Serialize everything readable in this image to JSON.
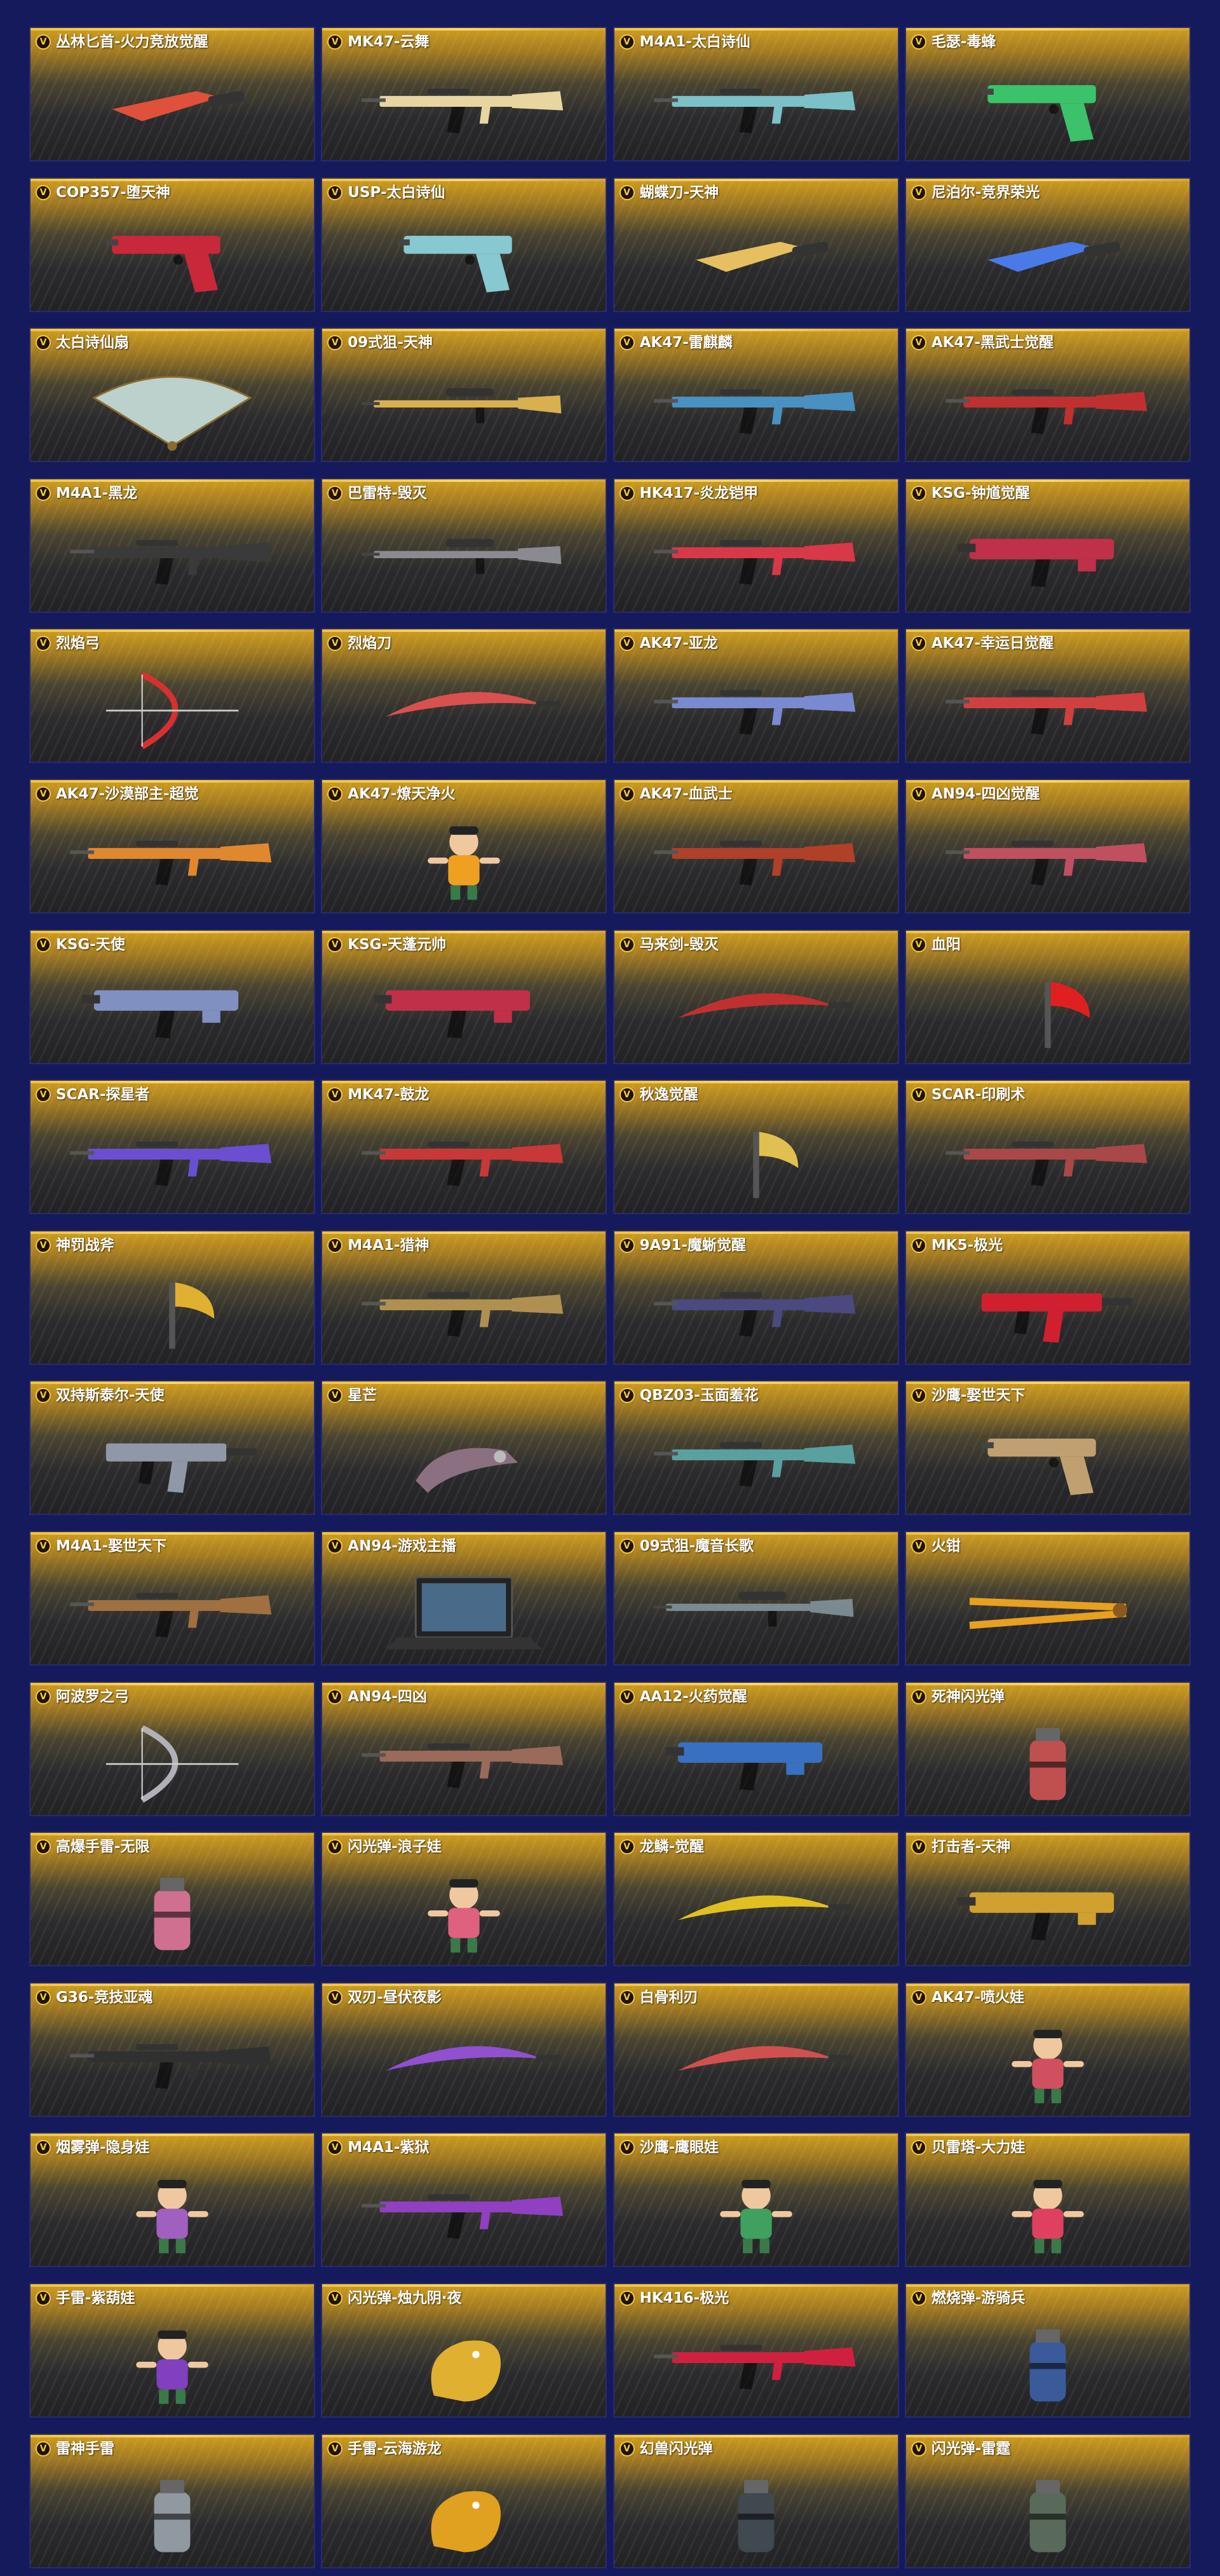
{
  "badge_letter": "V",
  "items": [
    {
      "name": "丛林匕首-火力竞放觉醒",
      "icon": "knife-icon",
      "color": "#e0503a"
    },
    {
      "name": "MK47-云舞",
      "icon": "rifle-icon",
      "color": "#e8d6a0"
    },
    {
      "name": "M4A1-太白诗仙",
      "icon": "rifle-icon",
      "color": "#7cc0c8"
    },
    {
      "name": "毛瑟-毒蜂",
      "icon": "pistol-icon",
      "color": "#3cc26a"
    },
    {
      "name": "COP357-堕天神",
      "icon": "pistol-icon",
      "color": "#c8283a"
    },
    {
      "name": "USP-太白诗仙",
      "icon": "pistol-icon",
      "color": "#88c8d0"
    },
    {
      "name": "蝴蝶刀-天神",
      "icon": "knife-icon",
      "color": "#e6c060"
    },
    {
      "name": "尼泊尔-竞界荣光",
      "icon": "knife-icon",
      "color": "#4a7ae8"
    },
    {
      "name": "太白诗仙扇",
      "icon": "fan-icon",
      "color": "#bcd0cc"
    },
    {
      "name": "09式狙-天神",
      "icon": "sniper-icon",
      "color": "#d8b050"
    },
    {
      "name": "AK47-雷麒麟",
      "icon": "rifle-icon",
      "color": "#4a90c0"
    },
    {
      "name": "AK47-黑武士觉醒",
      "icon": "rifle-icon",
      "color": "#c03030"
    },
    {
      "name": "M4A1-黑龙",
      "icon": "rifle-icon",
      "color": "#3a3a3a"
    },
    {
      "name": "巴雷特-毁灭",
      "icon": "sniper-icon",
      "color": "#8a8a90"
    },
    {
      "name": "HK417-炎龙铠甲",
      "icon": "rifle-icon",
      "color": "#d83848"
    },
    {
      "name": "KSG-钟馗觉醒",
      "icon": "shotgun-icon",
      "color": "#c03048"
    },
    {
      "name": "烈焰弓",
      "icon": "bow-icon",
      "color": "#d83030"
    },
    {
      "name": "烈焰刀",
      "icon": "blade-icon",
      "color": "#d85050"
    },
    {
      "name": "AK47-亚龙",
      "icon": "rifle-icon",
      "color": "#7a8ad0"
    },
    {
      "name": "AK47-幸运日觉醒",
      "icon": "rifle-icon",
      "color": "#d04040"
    },
    {
      "name": "AK47-沙漠部主-超觉",
      "icon": "rifle-icon",
      "color": "#e08830"
    },
    {
      "name": "AK47-燎天净火",
      "icon": "doll-icon",
      "color": "#f0a020"
    },
    {
      "name": "AK47-血武士",
      "icon": "rifle-icon",
      "color": "#b04028"
    },
    {
      "name": "AN94-四凶觉醒",
      "icon": "rifle-icon",
      "color": "#c05060"
    },
    {
      "name": "KSG-天使",
      "icon": "shotgun-icon",
      "color": "#8090c0"
    },
    {
      "name": "KSG-天蓬元帅",
      "icon": "shotgun-icon",
      "color": "#c03048"
    },
    {
      "name": "马来剑-毁灭",
      "icon": "blade-icon",
      "color": "#c03030"
    },
    {
      "name": "血阳",
      "icon": "axe-icon",
      "color": "#e02020"
    },
    {
      "name": "SCAR-探星者",
      "icon": "rifle-icon",
      "color": "#6a50d0"
    },
    {
      "name": "MK47-鼓龙",
      "icon": "rifle-icon",
      "color": "#c83838"
    },
    {
      "name": "秋逸觉醒",
      "icon": "axe-icon",
      "color": "#e0c050"
    },
    {
      "name": "SCAR-印刷术",
      "icon": "rifle-icon",
      "color": "#a84848"
    },
    {
      "name": "神罚战斧",
      "icon": "axe-icon",
      "color": "#e0b030"
    },
    {
      "name": "M4A1-猎神",
      "icon": "rifle-icon",
      "color": "#b09050"
    },
    {
      "name": "9A91-魔蜥觉醒",
      "icon": "rifle-icon",
      "color": "#4a4a80"
    },
    {
      "name": "MK5-极光",
      "icon": "smg-icon",
      "color": "#d02030"
    },
    {
      "name": "双持斯泰尔-天使",
      "icon": "smg-icon",
      "color": "#9098a8"
    },
    {
      "name": "星芒",
      "icon": "gauntlet-icon",
      "color": "#8a7080"
    },
    {
      "name": "QBZ03-玉面羞花",
      "icon": "rifle-icon",
      "color": "#5aa0a0"
    },
    {
      "name": "沙鹰-娶世天下",
      "icon": "pistol-icon",
      "color": "#c0a070"
    },
    {
      "name": "M4A1-娶世天下",
      "icon": "rifle-icon",
      "color": "#a07040"
    },
    {
      "name": "AN94-游戏主播",
      "icon": "laptop-icon",
      "color": "#202020"
    },
    {
      "name": "09式狙-魔音长歌",
      "icon": "sniper-icon",
      "color": "#7a8a90"
    },
    {
      "name": "火钳",
      "icon": "tongs-icon",
      "color": "#e8a020"
    },
    {
      "name": "阿波罗之弓",
      "icon": "bow-icon",
      "color": "#b0b0b8"
    },
    {
      "name": "AN94-四凶",
      "icon": "rifle-icon",
      "color": "#9a6a5a"
    },
    {
      "name": "AA12-火药觉醒",
      "icon": "shotgun-icon",
      "color": "#3a70c0"
    },
    {
      "name": "死神闪光弹",
      "icon": "grenade-icon",
      "color": "#c05050"
    },
    {
      "name": "高爆手雷-无限",
      "icon": "grenade-icon",
      "color": "#d07090"
    },
    {
      "name": "闪光弹-浪子娃",
      "icon": "doll-icon",
      "color": "#e06080"
    },
    {
      "name": "龙鳞-觉醒",
      "icon": "blade-icon",
      "color": "#e0c020"
    },
    {
      "name": "打击者-天神",
      "icon": "shotgun-icon",
      "color": "#d0a030"
    },
    {
      "name": "G36-竞技亚魂",
      "icon": "rifle-icon",
      "color": "#303030"
    },
    {
      "name": "双刃-昼伏夜影",
      "icon": "blade-icon",
      "color": "#9050d0"
    },
    {
      "name": "白骨利刃",
      "icon": "blade-icon",
      "color": "#d05050"
    },
    {
      "name": "AK47-喷火娃",
      "icon": "doll-icon",
      "color": "#d05060"
    },
    {
      "name": "烟雾弹-隐身娃",
      "icon": "doll-icon",
      "color": "#a060c0"
    },
    {
      "name": "M4A1-紫狱",
      "icon": "rifle-icon",
      "color": "#9040c0"
    },
    {
      "name": "沙鹰-鹰眼娃",
      "icon": "doll-icon",
      "color": "#40a060"
    },
    {
      "name": "贝雷塔-大力娃",
      "icon": "doll-icon",
      "color": "#e04060"
    },
    {
      "name": "手雷-紫葫娃",
      "icon": "doll-icon",
      "color": "#8040c0"
    },
    {
      "name": "闪光弹-烛九阴·夜",
      "icon": "dragon-icon",
      "color": "#e0b030"
    },
    {
      "name": "HK416-极光",
      "icon": "rifle-icon",
      "color": "#d02040"
    },
    {
      "name": "燃烧弹-游骑兵",
      "icon": "grenade-icon",
      "color": "#3a5a9a"
    },
    {
      "name": "雷神手雷",
      "icon": "grenade-icon",
      "color": "#9098a0"
    },
    {
      "name": "手雷-云海游龙",
      "icon": "dragon-icon",
      "color": "#e0a020"
    },
    {
      "name": "幻兽闪光弹",
      "icon": "grenade-icon",
      "color": "#404850"
    },
    {
      "name": "闪光弹-雷霆",
      "icon": "grenade-icon",
      "color": "#5a6a5a"
    }
  ]
}
